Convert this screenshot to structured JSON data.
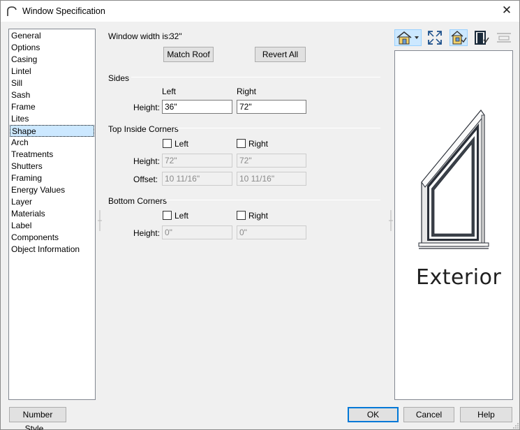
{
  "window": {
    "title": "Window Specification"
  },
  "sidebar": {
    "items": [
      {
        "label": "General"
      },
      {
        "label": "Options"
      },
      {
        "label": "Casing"
      },
      {
        "label": "Lintel"
      },
      {
        "label": "Sill"
      },
      {
        "label": "Sash"
      },
      {
        "label": "Frame"
      },
      {
        "label": "Lites"
      },
      {
        "label": "Shape",
        "selected": true
      },
      {
        "label": "Arch"
      },
      {
        "label": "Treatments"
      },
      {
        "label": "Shutters"
      },
      {
        "label": "Framing"
      },
      {
        "label": "Energy Values"
      },
      {
        "label": "Layer"
      },
      {
        "label": "Materials"
      },
      {
        "label": "Label"
      },
      {
        "label": "Components"
      },
      {
        "label": "Object Information"
      }
    ]
  },
  "main": {
    "width_label": "Window width is:",
    "width_value": "32\"",
    "match_roof_label": "Match Roof",
    "revert_all_label": "Revert All",
    "sides": {
      "title": "Sides",
      "left_header": "Left",
      "right_header": "Right",
      "height_label": "Height:",
      "left_height": "36\"",
      "right_height": "72\""
    },
    "top_inside_corners": {
      "title": "Top Inside Corners",
      "left_label": "Left",
      "right_label": "Right",
      "left_checked": false,
      "right_checked": false,
      "height_label": "Height:",
      "left_height": "72\"",
      "right_height": "72\"",
      "offset_label": "Offset:",
      "left_offset": "10 11/16\"",
      "right_offset": "10 11/16\""
    },
    "bottom_corners": {
      "title": "Bottom Corners",
      "left_label": "Left",
      "right_label": "Right",
      "left_checked": false,
      "right_checked": false,
      "height_label": "Height:",
      "left_height": "0\"",
      "right_height": "0\""
    }
  },
  "preview": {
    "label": "Exterior",
    "toolbar": [
      "house-view-dropdown-icon",
      "fill-window-icon",
      "exterior-view-icon",
      "interior-view-icon",
      "plan-view-icon"
    ]
  },
  "footer": {
    "number_style_label": "Number Style...",
    "ok_label": "OK",
    "cancel_label": "Cancel",
    "help_label": "Help"
  },
  "colors": {
    "selection": "#cce8ff",
    "accent": "#0078d7",
    "frame": "#2a2f38"
  }
}
